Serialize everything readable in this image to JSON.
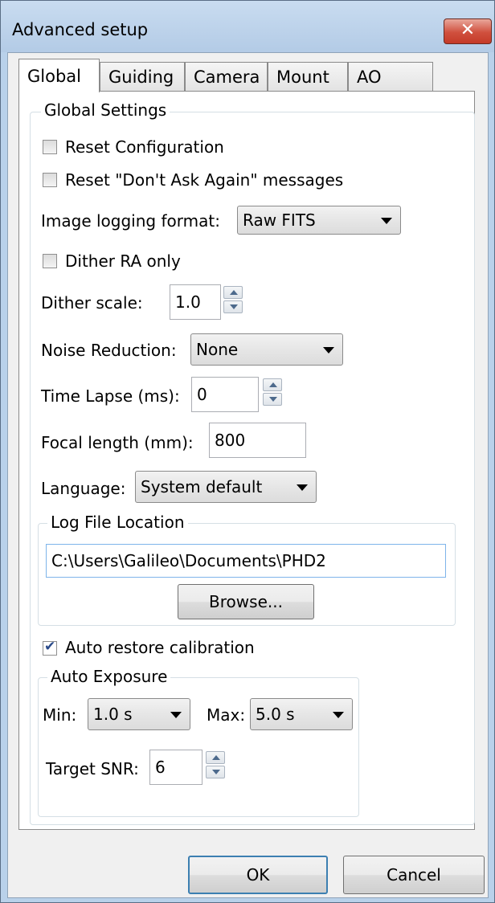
{
  "window": {
    "title": "Advanced setup",
    "close_glyph": "✕"
  },
  "tabs": [
    "Global",
    "Guiding",
    "Camera",
    "Mount",
    "AO"
  ],
  "global_settings": {
    "legend": "Global Settings",
    "reset_config": {
      "label": "Reset Configuration",
      "checked": false
    },
    "reset_dont_ask": {
      "label": "Reset \"Don't Ask Again\" messages",
      "checked": false
    },
    "image_logging_format": {
      "label": "Image logging format:",
      "value": "Raw FITS"
    },
    "dither_ra_only": {
      "label": "Dither RA only",
      "checked": false
    },
    "dither_scale": {
      "label": "Dither scale:",
      "value": "1.0"
    },
    "noise_reduction": {
      "label": "Noise Reduction:",
      "value": "None"
    },
    "time_lapse": {
      "label": "Time Lapse (ms):",
      "value": "0"
    },
    "focal_length": {
      "label": "Focal length (mm):",
      "value": "800"
    },
    "language": {
      "label": "Language:",
      "value": "System default"
    }
  },
  "log_file": {
    "legend": "Log File Location",
    "path": "C:\\Users\\Galileo\\Documents\\PHD2",
    "browse_label": "Browse..."
  },
  "auto_restore": {
    "label": "Auto restore calibration",
    "checked": true
  },
  "auto_exposure": {
    "legend": "Auto Exposure",
    "min_label": "Min:",
    "min_value": "1.0 s",
    "max_label": "Max:",
    "max_value": "5.0 s",
    "snr_label": "Target SNR:",
    "snr_value": "6"
  },
  "buttons": {
    "ok": "OK",
    "cancel": "Cancel"
  }
}
